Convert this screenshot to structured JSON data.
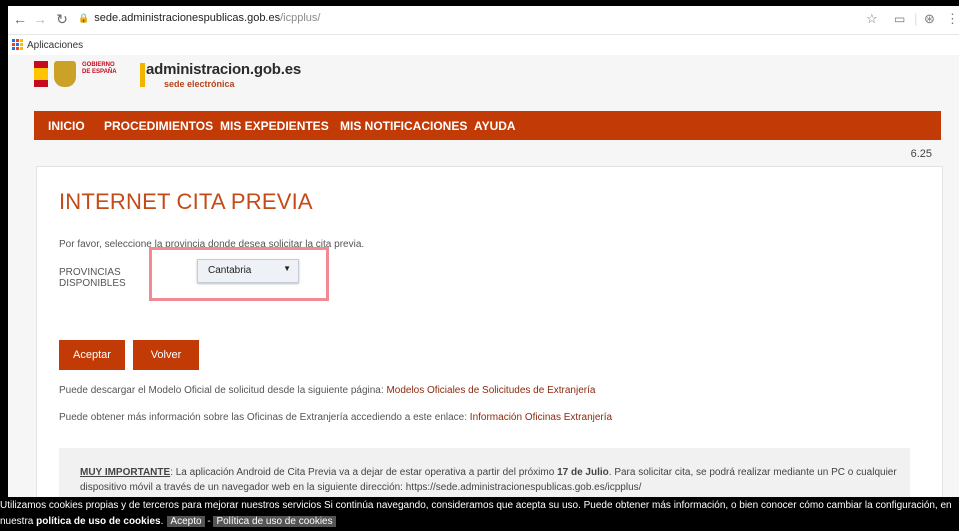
{
  "browser": {
    "url_domain": "sede.administracionespublicas.gob.es",
    "url_path": "/icpplus/",
    "bookmarks_label": "Aplicaciones"
  },
  "logo": {
    "gov_text_1": "GOBIERNO",
    "gov_text_2": "DE ESPAÑA",
    "brand": "administracion.gob.es",
    "sub": "sede electrónica"
  },
  "menu": [
    "INICIO",
    "PROCEDIMIENTOS",
    "MIS EXPEDIENTES",
    "MIS NOTIFICACIONES",
    "AYUDA"
  ],
  "version": "6.25",
  "main": {
    "title": "INTERNET CITA PREVIA",
    "intro": "Por favor, seleccione la provincia donde desea solicitar la cita previa.",
    "prov_label_1": "PROVINCIAS",
    "prov_label_2": "DISPONIBLES",
    "selected_province": "Cantabria",
    "accept_label": "Aceptar",
    "back_label": "Volver",
    "model_text": "Puede descargar el Modelo Oficial de solicitud desde la siguiente página: ",
    "model_link": "Modelos Oficiales de Solicitudes de Extranjería",
    "info_text": "Puede obtener más información sobre las Oficinas de Extranjería accediendo a este enlace: ",
    "info_link": "Información Oficinas Extranjería"
  },
  "notice": {
    "heading": "MUY IMPORTANTE",
    "text_a": ": La aplicación Android de Cita Previa va a dejar de estar operativa a partir del próximo ",
    "date": "17 de Julio",
    "text_b": ". Para solicitar cita, se podrá realizar mediante un PC o cualquier dispositivo móvil a través de un navegador web en la siguiente dirección: https://sede.administracionespublicas.gob.es/icpplus/"
  },
  "cookie": {
    "line1": "Utilizamos cookies propias y de terceros para mejorar nuestros servicios Si continúa navegando, consideramos que acepta su uso. Puede obtener más información, o bien conocer cómo cambiar la configuración, en",
    "line2_a": "nuestra ",
    "line2_bold": "política de uso de cookies",
    "line2_b": ".",
    "accept": "Acepto",
    "sep": " - ",
    "policy": "Política de uso de cookies"
  },
  "colors": {
    "accent": "#c23a06",
    "title": "#c44a18",
    "highlight": "#f28a94"
  }
}
